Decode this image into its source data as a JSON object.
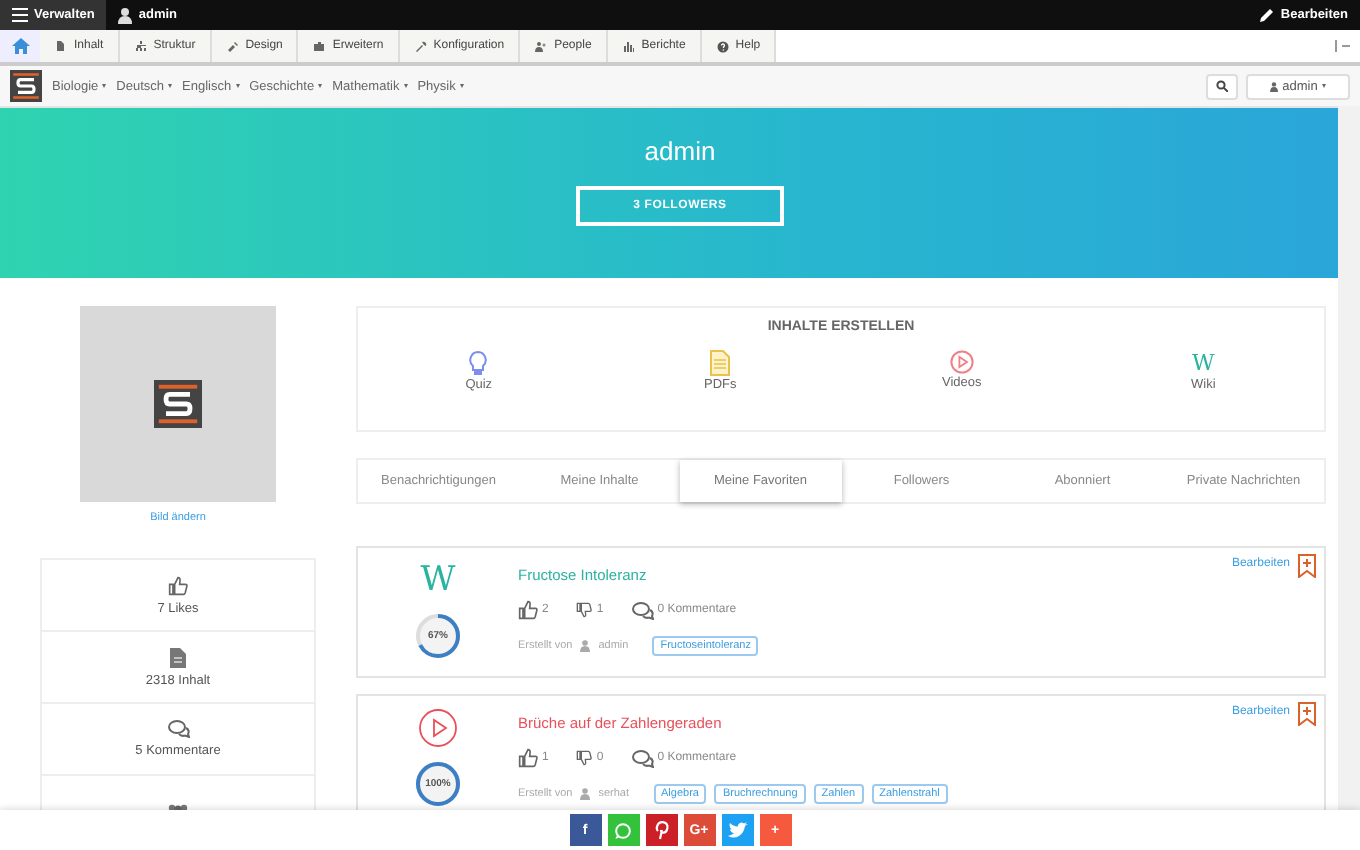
{
  "admin_bar": {
    "menu": "Verwalten",
    "user": "admin",
    "edit": "Bearbeiten"
  },
  "toolbar": [
    "Inhalt",
    "Struktur",
    "Design",
    "Erweitern",
    "Konfiguration",
    "People",
    "Berichte",
    "Help"
  ],
  "nav": {
    "subjects": [
      "Biologie",
      "Deutsch",
      "Englisch",
      "Geschichte",
      "Mathematik",
      "Physik"
    ],
    "user": "admin"
  },
  "hero": {
    "name": "admin",
    "followers": "3 FOLLOWERS"
  },
  "profile": {
    "change_picture": "Bild ändern"
  },
  "stats": [
    {
      "kind": "likes",
      "label": "7 Likes"
    },
    {
      "kind": "content",
      "label": "2318 Inhalt"
    },
    {
      "kind": "comments",
      "label": "5 Kommentare"
    },
    {
      "kind": "group"
    }
  ],
  "create": {
    "title": "INHALTE ERSTELLEN",
    "items": [
      {
        "kind": "quiz",
        "label": "Quiz"
      },
      {
        "kind": "pdf",
        "label": "PDFs"
      },
      {
        "kind": "video",
        "label": "Videos"
      },
      {
        "kind": "wiki",
        "glyph": "W",
        "label": "Wiki"
      }
    ]
  },
  "tabs": [
    {
      "label": "Benachrichtigungen",
      "selected": false
    },
    {
      "label": "Meine Inhalte",
      "selected": false
    },
    {
      "label": "Meine Favoriten",
      "selected": true
    },
    {
      "label": "Followers",
      "selected": false
    },
    {
      "label": "Abonniert",
      "selected": false
    },
    {
      "label": "Private Nachrichten",
      "selected": false
    }
  ],
  "cards": [
    {
      "kind": "wiki",
      "glyph": "W",
      "level": 0.67,
      "progress": "67%",
      "title": "Fructose Intoleranz",
      "likes": "2",
      "dislikes": "1",
      "comments": "0 Kommentare",
      "created": "Erstellt von",
      "author": "admin",
      "tags": [
        "Fructoseintoleranz"
      ],
      "edit": "Bearbeiten"
    },
    {
      "kind": "video",
      "level": 1,
      "progress": "100%",
      "title": "Brüche auf der Zahlengeraden",
      "likes": "1",
      "dislikes": "0",
      "comments": "0 Kommentare",
      "created": "Erstellt von",
      "author": "serhat",
      "tags": [
        "Algebra",
        "Bruchrechnung",
        "Zahlen",
        "Zahlenstrahl"
      ],
      "edit": "Bearbeiten"
    }
  ],
  "share": [
    {
      "kind": "facebook",
      "glyph": "f"
    },
    {
      "kind": "whatsapp"
    },
    {
      "kind": "pinterest"
    },
    {
      "kind": "googleplus",
      "glyph": "G+"
    },
    {
      "kind": "twitter"
    },
    {
      "kind": "more",
      "glyph": "+"
    }
  ]
}
